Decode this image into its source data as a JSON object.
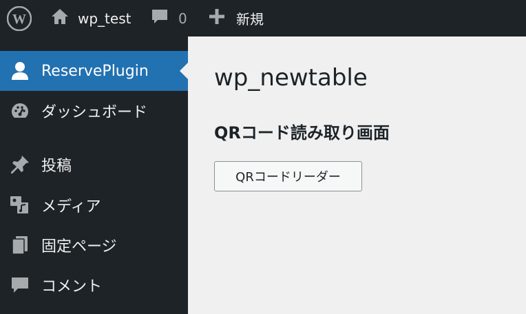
{
  "adminbar": {
    "logo_icon": "wordpress-logo-icon",
    "site_name": "wp_test",
    "site_icon": "home-icon",
    "comments_icon": "comment-bubble-icon",
    "comments_count": "0",
    "new_icon": "plus-icon",
    "new_label": "新規"
  },
  "sidebar": {
    "items": [
      {
        "label": "ReservePlugin",
        "icon": "user-icon",
        "current": true
      },
      {
        "label": "ダッシュボード",
        "icon": "dashboard-gauge-icon"
      },
      {
        "label": "投稿",
        "icon": "pushpin-icon"
      },
      {
        "label": "メディア",
        "icon": "media-icon"
      },
      {
        "label": "固定ページ",
        "icon": "pages-icon"
      },
      {
        "label": "コメント",
        "icon": "comment-bubble-icon"
      }
    ]
  },
  "main": {
    "title": "wp_newtable",
    "section_title": "QRコード読み取り画面",
    "button_label": "QRコードリーダー"
  },
  "colors": {
    "adminbar_bg": "#1d2327",
    "accent": "#2271b1",
    "content_bg": "#f0f0f1"
  }
}
